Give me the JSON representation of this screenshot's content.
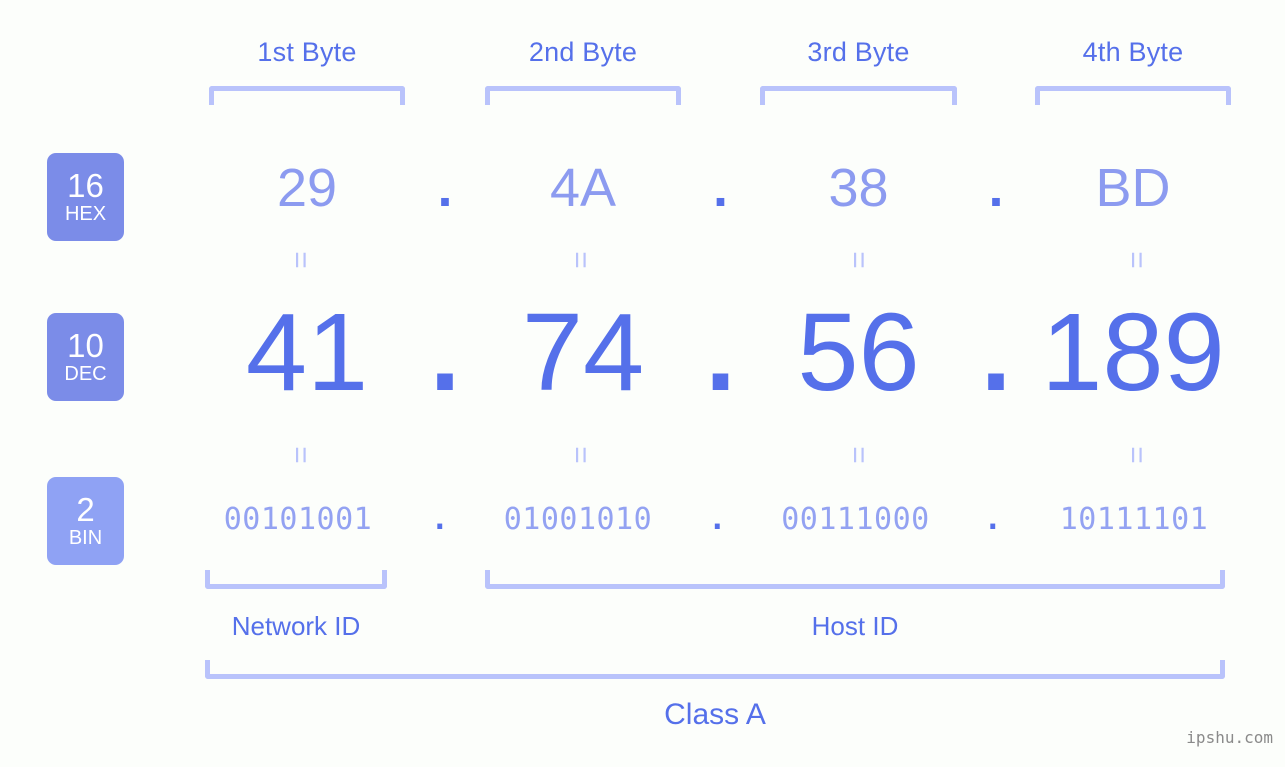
{
  "ip_address": "41.74.56.189",
  "ip_class": "Class A",
  "background_color": "#fcfefb",
  "colors": {
    "accent_strong": "#5570ea",
    "accent_light": "#8c9bf0",
    "bracket": "#b9c3fb",
    "badge_hex": "#7b8ce8",
    "badge_dec": "#7b8ce8",
    "badge_bin": "#8fa2f4",
    "watermark": "#8a8a8a"
  },
  "byte_headers": [
    {
      "label": "1st Byte"
    },
    {
      "label": "2nd Byte"
    },
    {
      "label": "3rd Byte"
    },
    {
      "label": "4th Byte"
    }
  ],
  "radix_badges": [
    {
      "number": "16",
      "abbr": "HEX"
    },
    {
      "number": "10",
      "abbr": "DEC"
    },
    {
      "number": "2",
      "abbr": "BIN"
    }
  ],
  "rows": {
    "hex": {
      "values": [
        "29",
        "4A",
        "38",
        "BD"
      ],
      "separator": "."
    },
    "dec": {
      "values": [
        "41",
        "74",
        "56",
        "189"
      ],
      "separator": "."
    },
    "bin": {
      "values": [
        "00101001",
        "01001010",
        "00111000",
        "10111101"
      ],
      "separator": "."
    }
  },
  "equality_marks": {
    "glyph": "=",
    "hex_to_dec_count": 4,
    "dec_to_bin_count": 4
  },
  "sections": [
    {
      "label": "Network ID"
    },
    {
      "label": "Host ID"
    }
  ],
  "watermark": "ipshu.com"
}
